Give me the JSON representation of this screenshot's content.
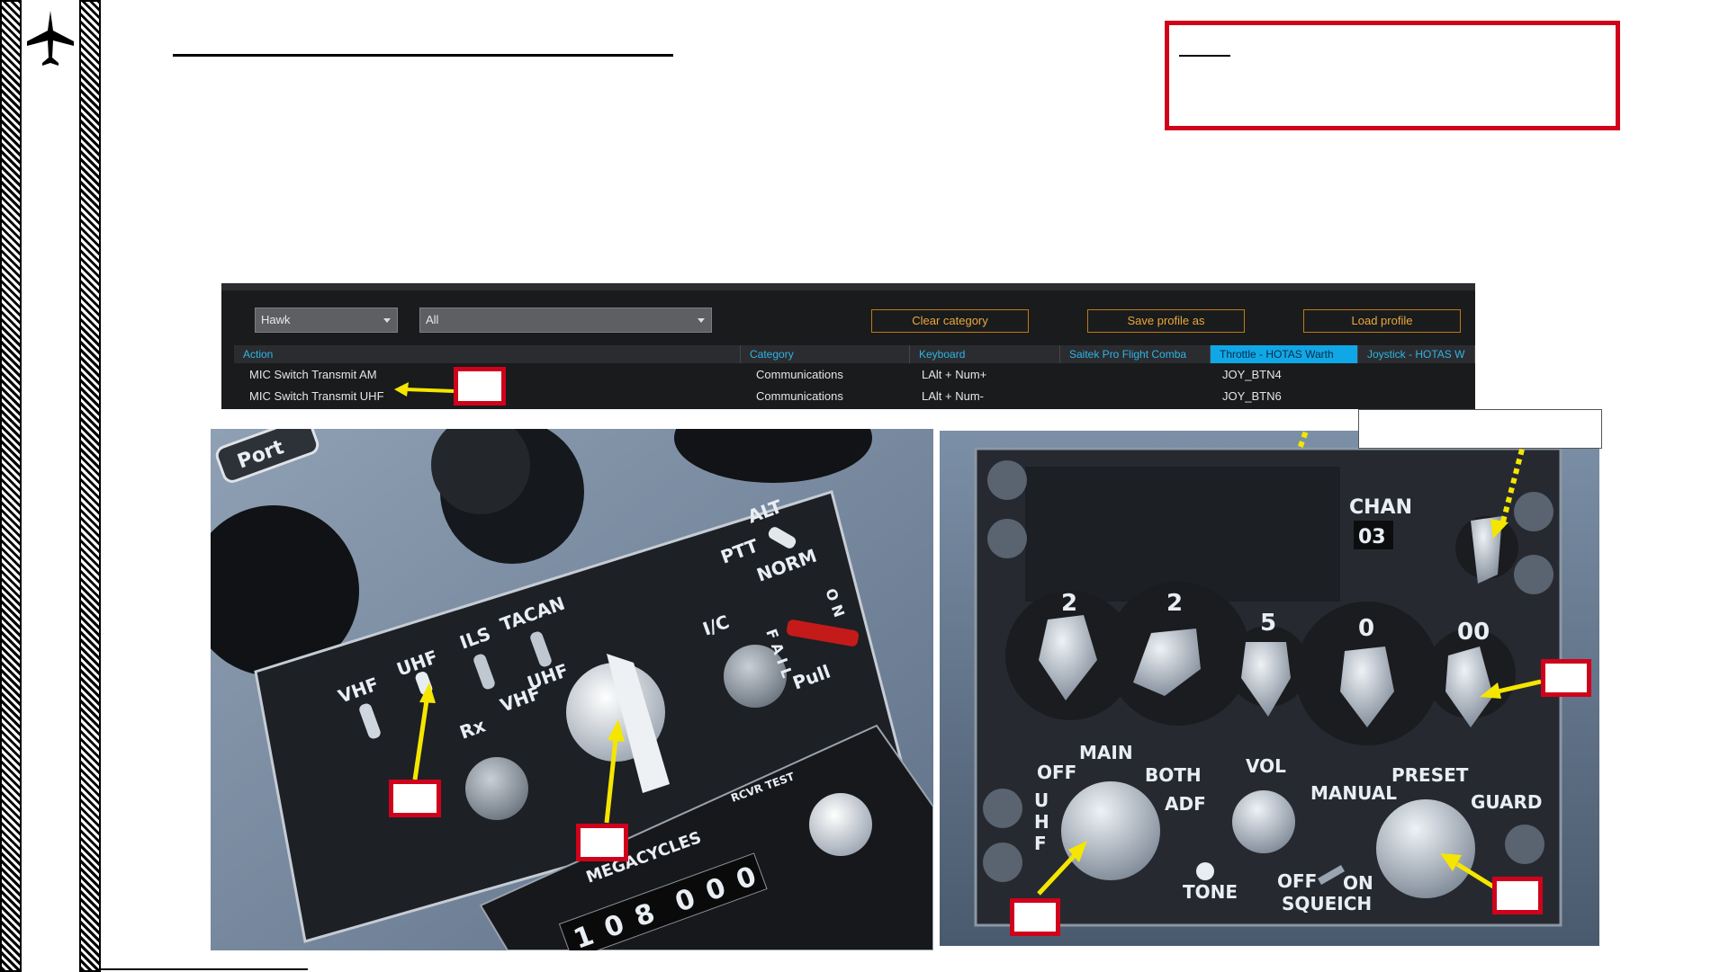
{
  "controls": {
    "aircraft_dropdown": "Hawk",
    "category_dropdown": "All",
    "buttons": {
      "clear": "Clear category",
      "save": "Save profile as",
      "load": "Load profile"
    },
    "headers": [
      "Action",
      "Category",
      "Keyboard",
      "Saitek Pro Flight Comba",
      "Throttle - HOTAS Warth",
      "Joystick - HOTAS W"
    ],
    "rows": [
      {
        "action": "MIC Switch Transmit AM",
        "category": "Communications",
        "keyboard": "LAlt + Num+",
        "saitek": "",
        "throttle": "JOY_BTN4",
        "joystick": ""
      },
      {
        "action": "MIC Switch Transmit UHF",
        "category": "Communications",
        "keyboard": "LAlt + Num-",
        "saitek": "",
        "throttle": "JOY_BTN6",
        "joystick": ""
      }
    ]
  },
  "left_panel": {
    "labels": {
      "port": "Port",
      "vhf": "VHF",
      "uhf": "UHF",
      "ils": "ILS",
      "tacan": "TACAN",
      "uhf_vhf_uhf": "UHF",
      "uhf_vhf_vhf": "VHF",
      "rx": "Rx",
      "alt": "ALT",
      "ptt": "PTT",
      "norm": "NORM",
      "ic": "I/C",
      "fail": "F A I L",
      "on": "O N",
      "pull": "Pull",
      "megacycles": "MEGACYCLES",
      "rcvr_test": "RCVR TEST",
      "freq_digits": [
        "1",
        "0",
        "8",
        "0",
        "0",
        "0"
      ]
    }
  },
  "right_panel": {
    "labels": {
      "chan": "CHAN",
      "chan_value": "03",
      "dials": [
        "2",
        "2",
        "5",
        "0",
        "00"
      ],
      "off": "OFF",
      "main": "MAIN",
      "both": "BOTH",
      "adf": "ADF",
      "uhf_vertical": [
        "U",
        "H",
        "F"
      ],
      "vol": "VOL",
      "manual": "MANUAL",
      "preset": "PRESET",
      "guard": "GUARD",
      "tone": "TONE",
      "off2": "OFF",
      "on": "ON",
      "squeich": "SQUEICH"
    }
  },
  "colors": {
    "marker_red": "#d0021b",
    "arrow_yellow": "#f5e600",
    "dcs_orange": "#e9a83a",
    "dcs_blue": "#2eb4e6"
  }
}
